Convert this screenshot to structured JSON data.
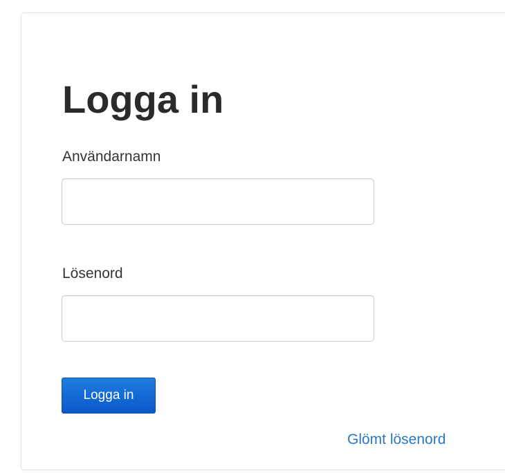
{
  "login": {
    "title": "Logga in",
    "username_label": "Användarnamn",
    "username_value": "",
    "password_label": "Lösenord",
    "password_value": "",
    "submit_label": "Logga in",
    "forgot_link": "Glömt lösenord"
  },
  "colors": {
    "button_blue": "#0a58c9",
    "link_blue": "#2a78c2",
    "title_text": "#2b2b2b"
  }
}
